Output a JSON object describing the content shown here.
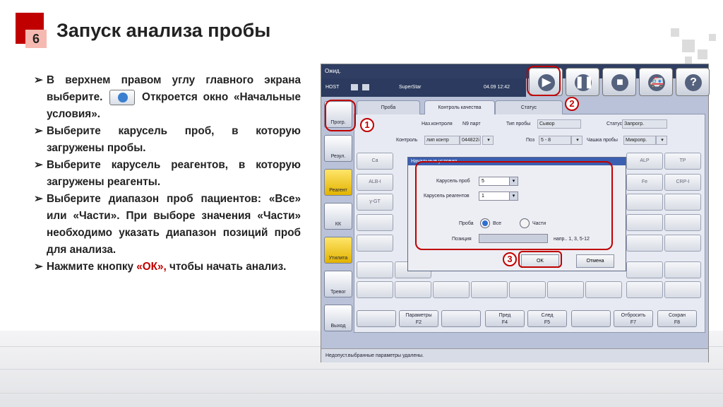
{
  "slide": {
    "number": "6",
    "title": "Запуск анализа пробы"
  },
  "bullets": [
    {
      "pre": "В верхнем правом углу главного экрана выберите.",
      "post": "Откроется окно «Начальные условия»."
    },
    {
      "text": "Выберите карусель проб, в которую загружены пробы."
    },
    {
      "text": "Выберите карусель реагентов, в которую загружены реагенты."
    },
    {
      "text": "Выберите диапазон проб пациентов: «Все» или «Части». При выборе значения «Части» необходимо указать диапазон позиций проб для анализа."
    },
    {
      "pre": "Нажмите кнопку",
      "hl": "«ОК»,",
      "post": "чтобы начать анализ."
    }
  ],
  "app": {
    "window_title": "Ожид.",
    "host": "HOST",
    "instrument": "SuperStar",
    "datetime": "04.09 12:42",
    "toolbar_icons": [
      "play-icon",
      "pause-icon",
      "stop-icon",
      "ambulance-icon",
      "help-icon"
    ],
    "sidebar": [
      "Прогр.",
      "Резул.",
      "Реагент",
      "КК",
      "Утилита",
      "Тревог",
      "Выход"
    ],
    "tabs": [
      "Проба",
      "Контроль качества",
      "Статус"
    ],
    "form": {
      "naz_label": "Наз.контроля",
      "lot_label": "N9 парт",
      "type_label": "Тип пробы",
      "type_value": "Сывор",
      "status_label": "Статус",
      "status_value": "Запрогр.",
      "control_label": "Контроль",
      "control_value": "лип контр",
      "control_lot": "044822i",
      "pos_label": "Поз",
      "pos_value": "5 - 8",
      "cup_label": "Чашка пробы",
      "cup_value": "Микропр."
    },
    "grid_labels": [
      "Ca",
      "ALB-I",
      "γ-GT",
      "ALP",
      "TP",
      "Fe",
      "CRP-I"
    ],
    "footer_buttons": [
      {
        "line1": "Параметры",
        "line2": "F2"
      },
      {
        "line1": "",
        "line2": ""
      },
      {
        "line1": "Пред",
        "line2": "F4"
      },
      {
        "line1": "След",
        "line2": "F5"
      },
      {
        "line1": "",
        "line2": ""
      },
      {
        "line1": "Отбросить",
        "line2": "F7"
      },
      {
        "line1": "Сохран",
        "line2": "F8"
      }
    ],
    "status_text": "Недопуст.выбранные параметры удалены.",
    "dialog": {
      "title": "Начальные условия",
      "sample_carousel_label": "Карусель проб",
      "sample_carousel_value": "5",
      "reagent_carousel_label": "Карусель реагентов",
      "reagent_carousel_value": "1",
      "sample_label": "Проба",
      "all_label": "Все",
      "parts_label": "Части",
      "position_label": "Позиция",
      "position_hint": "напр.. 1, 3, 5-12",
      "ok": "OK",
      "cancel": "Отмена"
    },
    "callouts": [
      "1",
      "2",
      "3"
    ],
    "accent_color": "#c00000"
  }
}
